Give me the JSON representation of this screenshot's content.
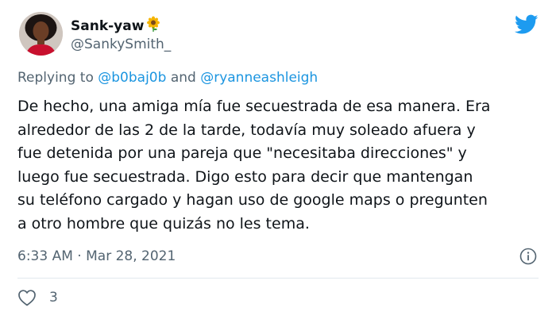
{
  "author": {
    "display_name": "Sank-yaw",
    "emoji": "sunflower-icon",
    "handle": "@SankySmith_"
  },
  "reply": {
    "prefix": "Replying to",
    "mention1": "@b0baj0b",
    "conjunction": "and",
    "mention2": "@ryanneashleigh"
  },
  "tweet": {
    "lines": [
      "De hecho, una amiga mía fue secuestrada de esa manera. Era",
      "alrededor de las 2 de la tarde, todavía muy soleado afuera y",
      "fue detenida por una pareja que \"necesitaba direcciones\" y",
      "luego fue secuestrada. Digo esto para decir que mantengan",
      "su teléfono cargado y hagan uso de google maps o pregunten",
      "a otro hombre que quizás no les tema."
    ]
  },
  "meta": {
    "time": "6:33 AM",
    "separator": "·",
    "date": "Mar 28, 2021"
  },
  "engagement": {
    "likes": "3"
  },
  "colors": {
    "twitter_blue": "#1d9bf0",
    "mention_blue": "#1b95e0",
    "secondary_text": "#536471",
    "primary_text": "#0f1419"
  },
  "icons": [
    "twitter-bird-icon",
    "sunflower-icon",
    "info-icon",
    "heart-icon"
  ]
}
